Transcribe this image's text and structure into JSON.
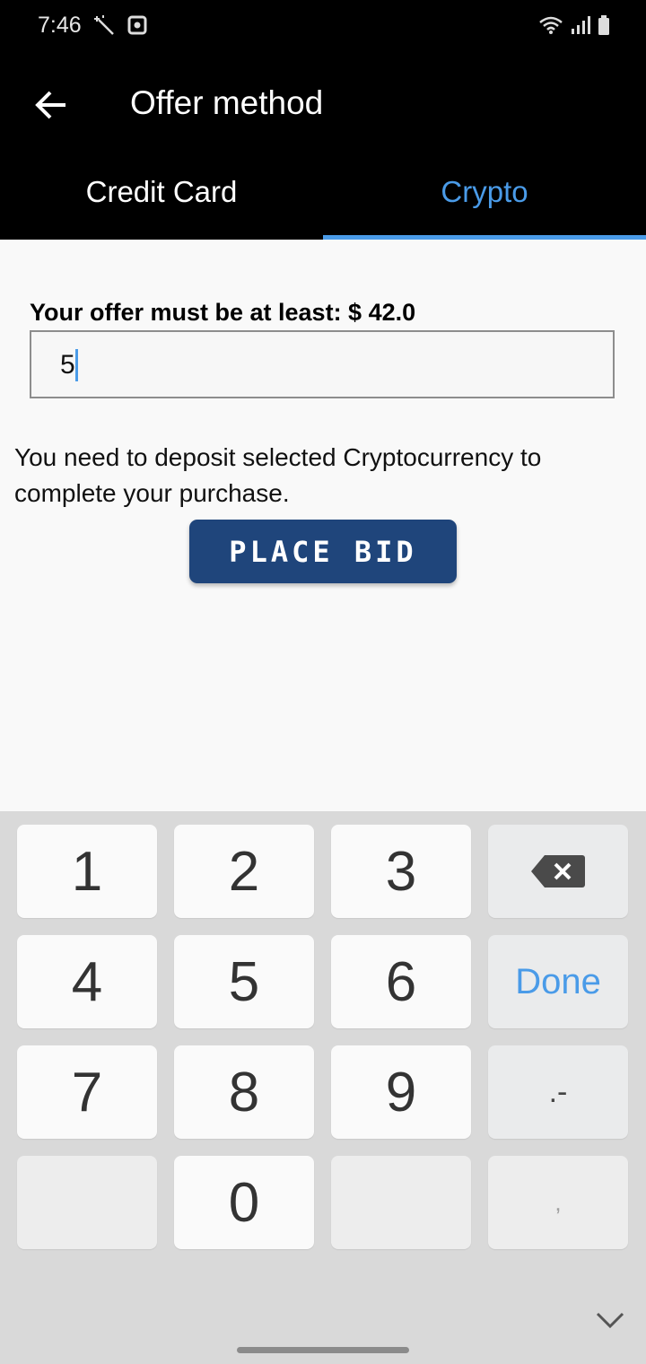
{
  "status_bar": {
    "time": "7:46",
    "icons": [
      "magic-wand-icon",
      "camera-icon",
      "wifi-icon",
      "signal-icon",
      "battery-icon"
    ]
  },
  "app_bar": {
    "title": "Offer method",
    "back_icon": "arrow-left-icon",
    "tabs": [
      {
        "label": "Credit Card",
        "selected": false
      },
      {
        "label": "Crypto",
        "selected": true
      }
    ]
  },
  "form": {
    "min_offer_label": "Your offer must be at least: $ 42.0",
    "offer_value": "5",
    "info": "You need to deposit selected Cryptocurrency to complete your purchase.",
    "place_bid_label": "PLACE BID"
  },
  "keyboard": {
    "keys": [
      "1",
      "2",
      "3",
      "4",
      "5",
      "6",
      "7",
      "8",
      "9",
      "0"
    ],
    "done_label": "Done",
    "dot_dash_label": ".-",
    "comma_label": ",",
    "backspace_icon": "backspace-icon",
    "hide_icon": "chevron-down-icon"
  },
  "colors": {
    "accent": "#4a9be8",
    "button": "#1f457b",
    "app_bar": "#000000"
  }
}
